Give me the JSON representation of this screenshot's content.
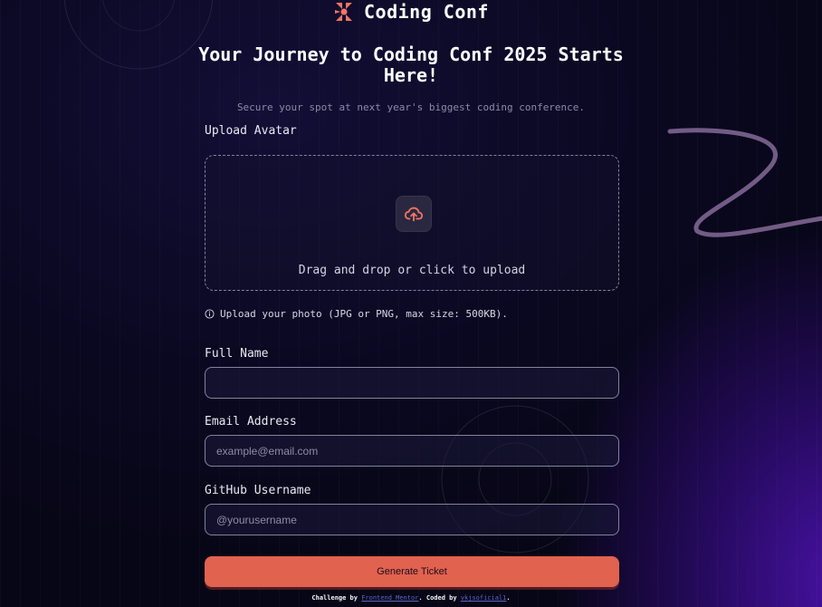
{
  "brand": {
    "name": "Coding Conf",
    "logo_icon": "conference-logo-icon",
    "accent": "#f57463"
  },
  "hero": {
    "title": "Your Journey to Coding Conf 2025 Starts Here!",
    "subtitle": "Secure your spot at next year's biggest coding conference."
  },
  "form": {
    "avatar": {
      "label": "Upload Avatar",
      "dropzone_text": "Drag and drop or click to upload",
      "icon": "cloud-upload-icon",
      "hint_icon": "info-icon",
      "hint": "Upload your photo (JPG or PNG, max size: 500KB)."
    },
    "full_name": {
      "label": "Full Name",
      "value": "",
      "placeholder": ""
    },
    "email": {
      "label": "Email Address",
      "value": "",
      "placeholder": "example@email.com"
    },
    "github": {
      "label": "GitHub Username",
      "value": "",
      "placeholder": "@yourusername"
    },
    "submit_label": "Generate Ticket",
    "button_color": "#e0624f"
  },
  "footer": {
    "prefix": "Challenge by",
    "challenge_link": "Frontend Mentor",
    "middle": ". Coded by",
    "author_link": "vkjsoficial1",
    "suffix": "."
  }
}
